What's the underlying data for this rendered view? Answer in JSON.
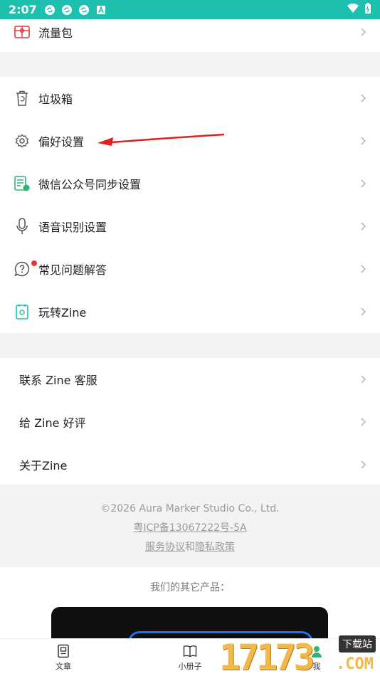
{
  "status": {
    "time": "2:07",
    "icons": [
      "sync-icon",
      "sync-icon",
      "sync-icon",
      "a-icon"
    ],
    "right_icons": [
      "wifi-icon",
      "battery-icon"
    ]
  },
  "menu_top": [
    {
      "label": "流量包",
      "icon": "data-package-icon"
    }
  ],
  "menu_main": [
    {
      "label": "垃圾箱",
      "icon": "trash-icon"
    },
    {
      "label": "偏好设置",
      "icon": "gear-icon"
    },
    {
      "label": "微信公众号同步设置",
      "icon": "wechat-doc-icon"
    },
    {
      "label": "语音识别设置",
      "icon": "microphone-icon"
    },
    {
      "label": "常见问题解答",
      "icon": "question-icon"
    },
    {
      "label": "玩转Zine",
      "icon": "book-icon"
    }
  ],
  "menu_contact": [
    {
      "label": "联系 Zine 客服"
    },
    {
      "label": "给 Zine 好评"
    },
    {
      "label": "关于Zine"
    }
  ],
  "footer": {
    "copyright": "©2026 Aura Marker Studio Co., Ltd.",
    "icp": "粤ICP备13067222号-5A",
    "terms": "服务协议",
    "and": "和",
    "privacy": "隐私政策"
  },
  "other_products_title": "我们的其它产品：",
  "tabs": [
    {
      "label": "文章",
      "icon": "article-icon"
    },
    {
      "label": "小册子",
      "icon": "booklet-icon"
    },
    {
      "label": "我",
      "icon": "profile-icon"
    }
  ],
  "watermark": {
    "number": "17173",
    "tag": "下载站",
    "domain": ".COM"
  },
  "colors": {
    "accent": "#1fbfb0",
    "arrow": "#e02020",
    "badge": "#e53935"
  }
}
